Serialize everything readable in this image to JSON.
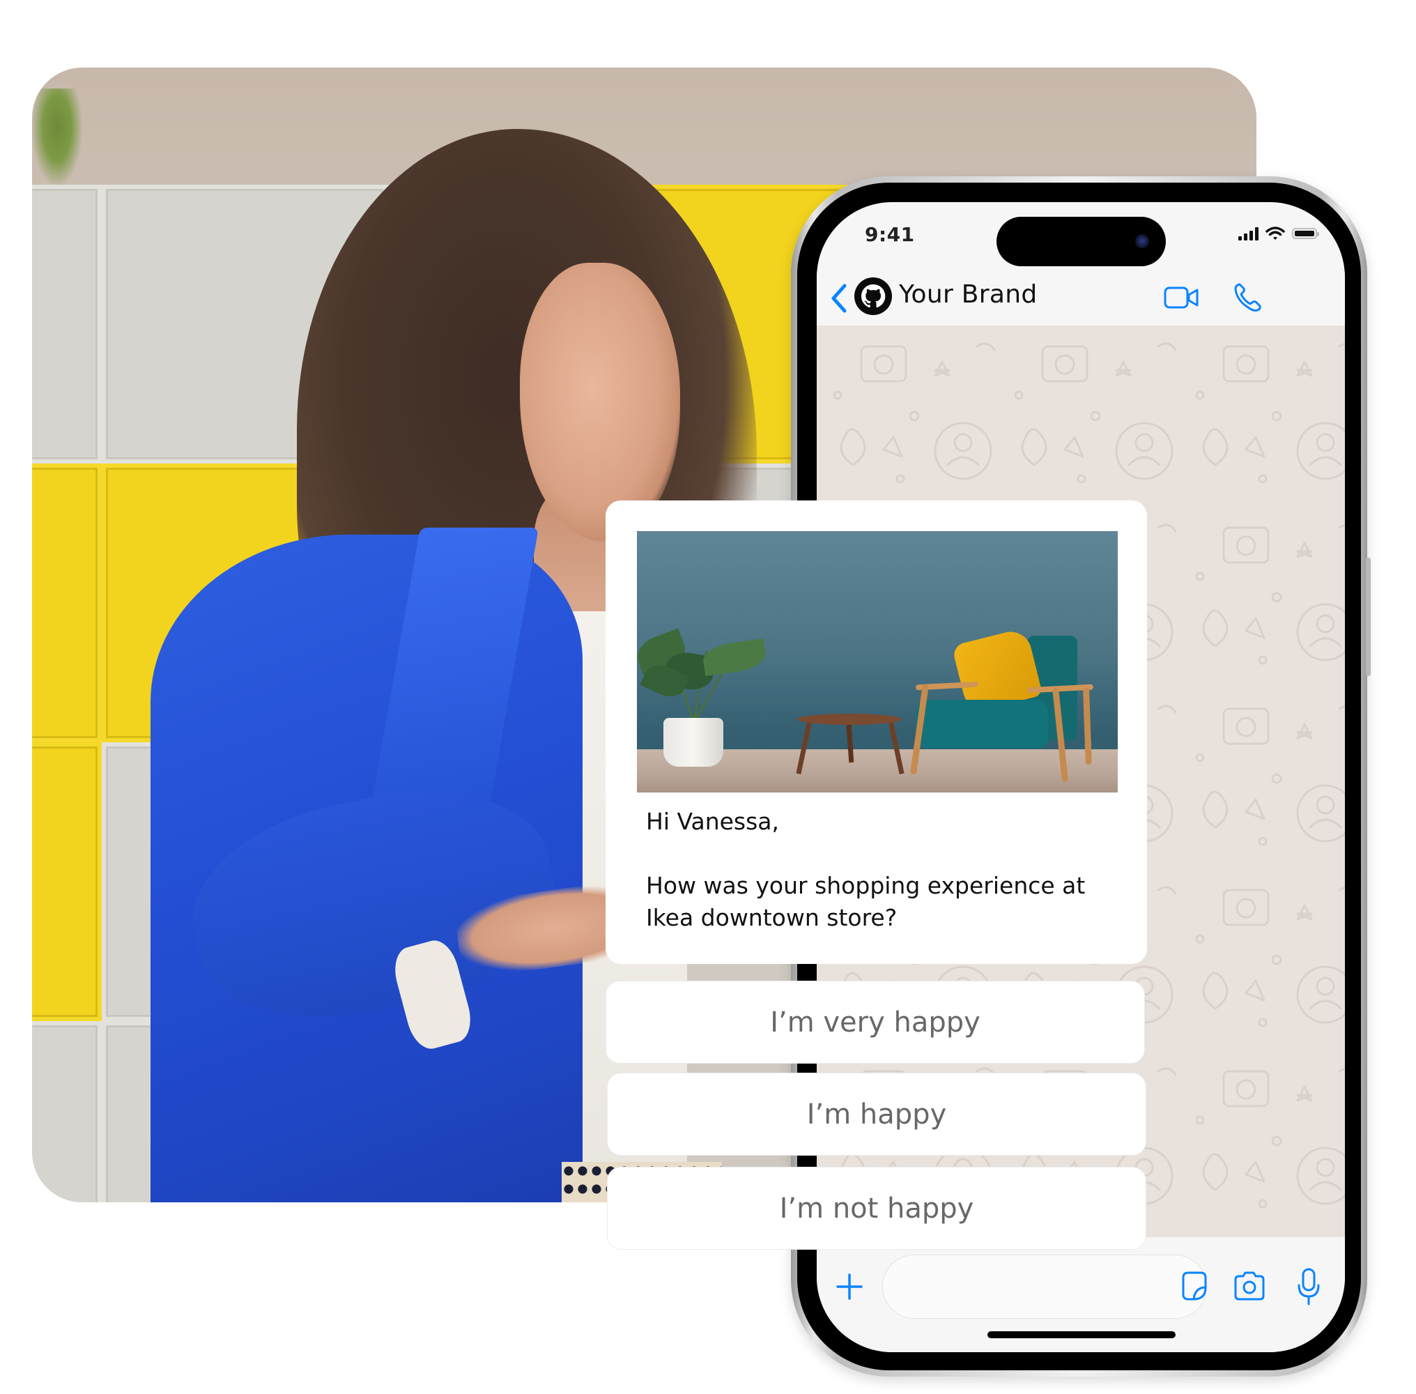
{
  "phone": {
    "status_bar": {
      "time": "9:41",
      "icons": [
        "cellular-signal-icon",
        "wifi-icon",
        "battery-icon"
      ]
    },
    "chat_header": {
      "back_icon": "chevron-left-icon",
      "avatar_icon": "github-logo-icon",
      "contact_name": "Your Brand",
      "actions": [
        {
          "name": "video-call",
          "icon": "video-camera-icon"
        },
        {
          "name": "voice-call",
          "icon": "phone-icon"
        }
      ]
    },
    "input_bar": {
      "attach_icon": "plus-icon",
      "message_value": "",
      "message_placeholder": "",
      "sticker_icon": "sticker-icon",
      "camera_icon": "camera-icon",
      "mic_icon": "microphone-icon"
    }
  },
  "message": {
    "image_description": "Living room with teal armchair, mustard pillow, round wooden side table and potted monstera plant against blue wall",
    "greeting": "Hi Vanessa,",
    "body": "How was your shopping experience at Ikea downtown store?"
  },
  "quick_replies": [
    {
      "label": "I’m very happy"
    },
    {
      "label": "I’m happy"
    },
    {
      "label": "I’m not happy"
    }
  ],
  "colors": {
    "accent_blue": "#0a84ff",
    "chat_background": "#e9e2dc",
    "reply_text": "#676767",
    "jacket_blue": "#2450d6",
    "cabinet_yellow": "#f2d41e"
  }
}
